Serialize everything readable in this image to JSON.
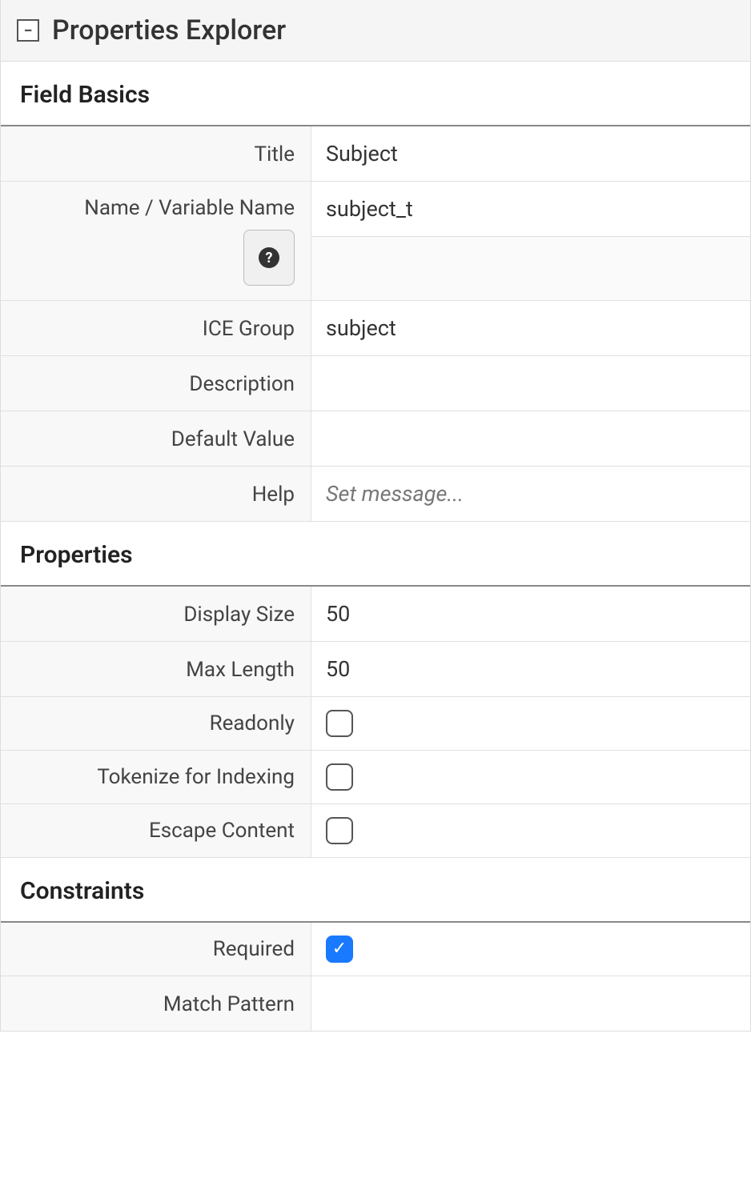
{
  "panel": {
    "title": "Properties Explorer",
    "collapse_symbol": "−"
  },
  "sections": {
    "field_basics": {
      "heading": "Field Basics",
      "rows": {
        "title": {
          "label": "Title",
          "value": "Subject"
        },
        "name": {
          "label": "Name / Variable Name",
          "value": "subject_t"
        },
        "ice_group": {
          "label": "ICE Group",
          "value": "subject"
        },
        "description": {
          "label": "Description",
          "value": ""
        },
        "default_value": {
          "label": "Default Value",
          "value": ""
        },
        "help": {
          "label": "Help",
          "value": "",
          "placeholder": "Set message..."
        }
      }
    },
    "properties": {
      "heading": "Properties",
      "rows": {
        "display_size": {
          "label": "Display Size",
          "value": "50"
        },
        "max_length": {
          "label": "Max Length",
          "value": "50"
        },
        "readonly": {
          "label": "Readonly",
          "checked": false
        },
        "tokenize": {
          "label": "Tokenize for Indexing",
          "checked": false
        },
        "escape": {
          "label": "Escape Content",
          "checked": false
        }
      }
    },
    "constraints": {
      "heading": "Constraints",
      "rows": {
        "required": {
          "label": "Required",
          "checked": true
        },
        "match_pattern": {
          "label": "Match Pattern",
          "value": ""
        }
      }
    }
  }
}
